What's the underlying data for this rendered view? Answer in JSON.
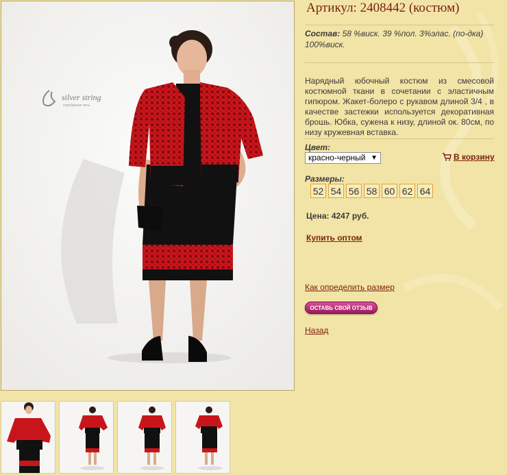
{
  "product": {
    "title": "Артикул: 2408442 (костюм)",
    "composition_label": "Состав:",
    "composition_value": " 58 %виск. 39 %пол. 3%элас. (по-дка) 100%виск.",
    "description": "Нарядный юбочный костюм из смесовой костюмной ткани в сочетании с эластичным гипюром. Жакет-болеро с рукавом длиной 3/4 , в качестве застежки используется декоративная брошь. Юбка, сужена к низу, длиной ок. 80см, по низу кружевная вставка.",
    "color_label": "Цвет:",
    "color_value": "красно-черный",
    "cart_label": "В корзину",
    "sizes_label": "Размеры:",
    "sizes": [
      "52",
      "54",
      "56",
      "58",
      "60",
      "62",
      "64"
    ],
    "price": "Цена: 4247 руб.",
    "wholesale_label": "Купить оптом",
    "how_size_label": "Как определить размер",
    "review_label": "ОСТАВЬ СВОЙ ОТЗЫВ",
    "back_label": "Назад"
  },
  "photo": {
    "logo_text": "silver string",
    "logo_sub": "серебряная нить"
  },
  "colors": {
    "background": "#f2e4a6",
    "accent": "#7a1f0c",
    "lace_red": "#c8151b",
    "size_border": "#e3a235"
  },
  "icons": {
    "cart": "cart-icon",
    "dropdown": "chevron-down-icon"
  }
}
